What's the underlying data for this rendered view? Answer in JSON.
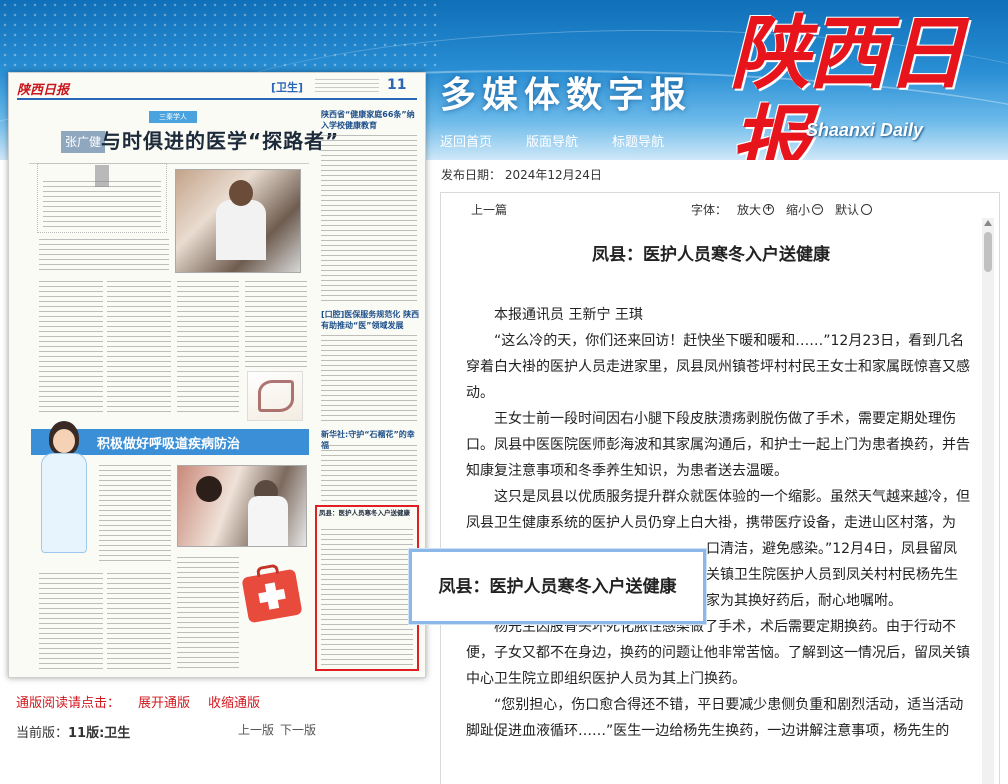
{
  "header": {
    "site_title": "多媒体数字报",
    "logo_cn": "陕西日报",
    "logo_en": "Shaanxi Daily",
    "nav": [
      "返回首页",
      "版面导航",
      "标题导航"
    ]
  },
  "newspaper_page": {
    "masthead": "陕西日报",
    "section": "[卫生]",
    "page_number": "11",
    "name_tag": "张广健",
    "kicker": "三秦学人",
    "headline": "与时俱进的医学“探路者”",
    "right_title_1": "陕西省“健康家庭66条”纳入学校健康教育",
    "right_title_2": "[口腔]医保服务规范化 陕西有助推动“医”领域发展",
    "right_title_3": "新华社:守护“石榴花”的幸福",
    "health_banner": "积极做好呼吸道疾病防治",
    "highlighted_article_title": "凤县：医护人员寒冬入户送健康"
  },
  "tooltip": {
    "text": "凤县：医护人员寒冬入户送健康"
  },
  "bottom": {
    "reading_prompt": "通版阅读请点击：",
    "expand_link": "展开通版",
    "collapse_link": "收缩通版",
    "current_page_label": "当前版：",
    "current_page_value": "11版:卫生",
    "prev_page": "上一版",
    "next_page": "下一版"
  },
  "article": {
    "pub_date": "发布日期：  2024年12月24日",
    "prev_article": "上一篇",
    "font_label": "字体：",
    "font_larger": "放大",
    "font_smaller": "缩小",
    "font_default": "默认",
    "title": "凤县：医护人员寒冬入户送健康",
    "byline": "本报通讯员  王新宁  王琪",
    "paragraphs": [
      "“这么冷的天，你们还来回访！赶快坐下暖和暖和……”12月23日，看到几名穿着白大褂的医护人员走进家里，凤县凤州镇苍坪村村民王女士和家属既惊喜又感动。",
      "王女士前一段时间因右小腿下段皮肤溃疡剥脱伤做了手术，需要定期处理伤口。凤县中医医院医师彭海波和其家属沟通后，和护士一起上门为患者换药，并告知康复注意事项和冬季养生知识，为患者送去温暖。",
      "这只是凤县以优质服务提升群众就医体验的一个缩影。虽然天气越来越冷，但凤县卫生健康系统的医护人员仍穿上白大褂，携带医疗设备，走进山区村落，为",
      "口清洁，避免感染。”12月4日，凤县留凤关镇卫生院医护人员到凤关村村民杨先生家为其换好药后，耐心地嘱咐。",
      "杨先生因股骨头坏死化脓性感染做了手术，术后需要定期换药。由于行动不便，子女又都不在身边，换药的问题让他非常苦恼。了解到这一情况后，留凤关镇中心卫生院立即组织医护人员为其上门换药。",
      "“您别担心，伤口愈合得还不错，平日要减少患侧负重和剧烈活动，适当活动脚趾促进血液循环……”医生一边给杨先生换药，一边讲解注意事项，杨先生的"
    ]
  }
}
